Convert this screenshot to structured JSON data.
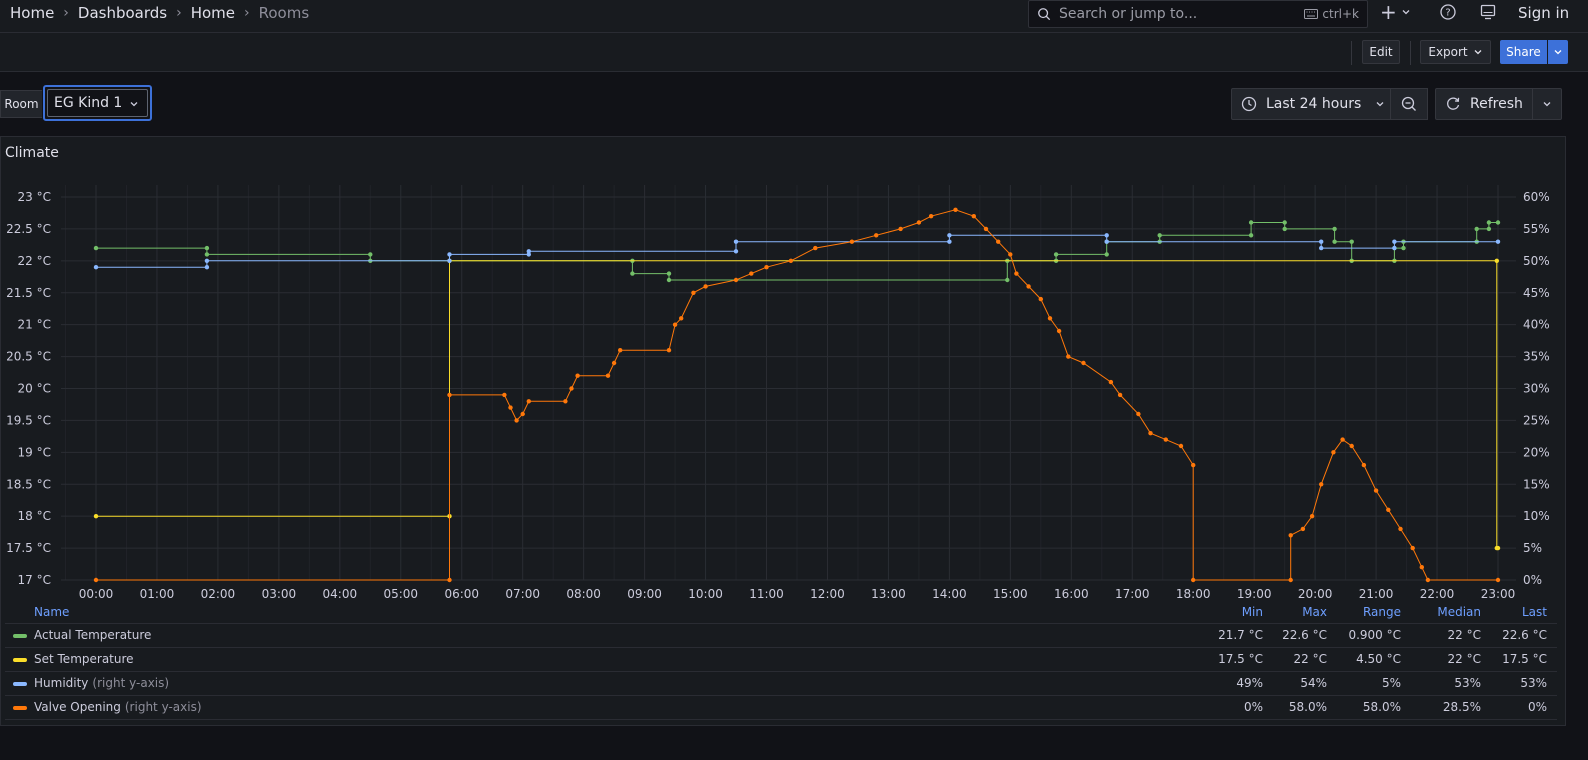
{
  "breadcrumbs": [
    "Home",
    "Dashboards",
    "Home",
    "Rooms"
  ],
  "search": {
    "placeholder": "Search or jump to...",
    "shortcut": "ctrl+k"
  },
  "top_right": {
    "signin": "Sign in"
  },
  "toolbar": {
    "edit": "Edit",
    "export": "Export",
    "share": "Share"
  },
  "variables": {
    "room_label": "Room",
    "room_value": "EG Kind 1"
  },
  "time_controls": {
    "range": "Last 24 hours",
    "refresh": "Refresh"
  },
  "panel": {
    "title": "Climate"
  },
  "colors": {
    "green": "#73bf69",
    "yellow": "#fade2a",
    "blue": "#8ab8ff",
    "orange": "#ff780a",
    "accent": "#3d71d9"
  },
  "legend": {
    "columns": [
      "Name",
      "Min",
      "Max",
      "Range",
      "Median",
      "Last"
    ],
    "rows": [
      {
        "name": "Actual Temperature",
        "axis": "",
        "color": "#73bf69",
        "min": "21.7 °C",
        "max": "22.6 °C",
        "range": "0.900 °C",
        "median": "22 °C",
        "last": "22.6 °C"
      },
      {
        "name": "Set Temperature",
        "axis": "",
        "color": "#fade2a",
        "min": "17.5 °C",
        "max": "22 °C",
        "range": "4.50 °C",
        "median": "22 °C",
        "last": "17.5 °C"
      },
      {
        "name": "Humidity",
        "axis": "(right y-axis)",
        "color": "#8ab8ff",
        "min": "49%",
        "max": "54%",
        "range": "5%",
        "median": "53%",
        "last": "53%"
      },
      {
        "name": "Valve Opening",
        "axis": "(right y-axis)",
        "color": "#ff780a",
        "min": "0%",
        "max": "58.0%",
        "range": "58.0%",
        "median": "28.5%",
        "last": "0%"
      }
    ]
  },
  "chart_data": {
    "type": "line",
    "title": "Climate",
    "x_ticks": [
      "00:00",
      "01:00",
      "02:00",
      "03:00",
      "04:00",
      "05:00",
      "06:00",
      "07:00",
      "08:00",
      "09:00",
      "10:00",
      "11:00",
      "12:00",
      "13:00",
      "14:00",
      "15:00",
      "16:00",
      "17:00",
      "18:00",
      "19:00",
      "20:00",
      "21:00",
      "22:00",
      "23:00"
    ],
    "x_unit": "hours",
    "x_range": [
      0,
      23
    ],
    "y_left": {
      "ticks": [
        "17 °C",
        "17.5 °C",
        "18 °C",
        "18.5 °C",
        "19 °C",
        "19.5 °C",
        "20 °C",
        "20.5 °C",
        "21 °C",
        "21.5 °C",
        "22 °C",
        "22.5 °C",
        "23 °C"
      ],
      "range": [
        17,
        23
      ]
    },
    "y_right": {
      "ticks": [
        "0%",
        "5%",
        "10%",
        "15%",
        "20%",
        "25%",
        "30%",
        "35%",
        "40%",
        "45%",
        "50%",
        "55%",
        "60%"
      ],
      "range": [
        0,
        60
      ]
    },
    "grid": true,
    "legend": "bottom-table",
    "series": [
      {
        "name": "Actual Temperature",
        "axis": "left",
        "color": "#73bf69",
        "points": [
          [
            0,
            22.2
          ],
          [
            1.82,
            22.2
          ],
          [
            1.82,
            22.1
          ],
          [
            4.5,
            22.1
          ],
          [
            4.5,
            22.0
          ],
          [
            8.8,
            22.0
          ],
          [
            8.8,
            21.8
          ],
          [
            9.4,
            21.8
          ],
          [
            9.4,
            21.7
          ],
          [
            14.95,
            21.7
          ],
          [
            14.95,
            22.0
          ],
          [
            15.75,
            22.0
          ],
          [
            15.75,
            22.1
          ],
          [
            16.58,
            22.1
          ],
          [
            16.58,
            22.3
          ],
          [
            17.45,
            22.3
          ],
          [
            17.45,
            22.4
          ],
          [
            18.95,
            22.4
          ],
          [
            18.95,
            22.6
          ],
          [
            19.5,
            22.6
          ],
          [
            19.5,
            22.5
          ],
          [
            20.32,
            22.5
          ],
          [
            20.32,
            22.3
          ],
          [
            20.6,
            22.3
          ],
          [
            20.6,
            22.0
          ],
          [
            21.3,
            22.0
          ],
          [
            21.3,
            22.2
          ],
          [
            21.45,
            22.2
          ],
          [
            21.45,
            22.3
          ],
          [
            22.65,
            22.3
          ],
          [
            22.65,
            22.5
          ],
          [
            22.85,
            22.5
          ],
          [
            22.85,
            22.6
          ],
          [
            23.0,
            22.6
          ]
        ]
      },
      {
        "name": "Set Temperature",
        "axis": "left",
        "color": "#fade2a",
        "points": [
          [
            0,
            18.0
          ],
          [
            5.8,
            18.0
          ],
          [
            5.8,
            22.0
          ],
          [
            22.98,
            22.0
          ],
          [
            22.98,
            17.5
          ],
          [
            23.0,
            17.5
          ]
        ]
      },
      {
        "name": "Humidity",
        "axis": "right",
        "color": "#8ab8ff",
        "points": [
          [
            0,
            49
          ],
          [
            1.82,
            49
          ],
          [
            1.82,
            50
          ],
          [
            5.8,
            50
          ],
          [
            5.8,
            51
          ],
          [
            7.1,
            51
          ],
          [
            7.1,
            51.5
          ],
          [
            10.5,
            51.5
          ],
          [
            10.5,
            53
          ],
          [
            14.0,
            53
          ],
          [
            14.0,
            54
          ],
          [
            16.58,
            54
          ],
          [
            16.58,
            53
          ],
          [
            20.1,
            53
          ],
          [
            20.1,
            52
          ],
          [
            21.3,
            52
          ],
          [
            21.3,
            53
          ],
          [
            23.0,
            53
          ]
        ]
      },
      {
        "name": "Valve Opening",
        "axis": "right",
        "color": "#ff780a",
        "points": [
          [
            0,
            0
          ],
          [
            5.8,
            0
          ],
          [
            5.8,
            29
          ],
          [
            6.7,
            29
          ],
          [
            6.8,
            27
          ],
          [
            6.9,
            25
          ],
          [
            7.0,
            26
          ],
          [
            7.1,
            28
          ],
          [
            7.7,
            28
          ],
          [
            7.8,
            30
          ],
          [
            7.9,
            32
          ],
          [
            8.4,
            32
          ],
          [
            8.5,
            34
          ],
          [
            8.6,
            36
          ],
          [
            9.4,
            36
          ],
          [
            9.5,
            40
          ],
          [
            9.6,
            41
          ],
          [
            9.8,
            45
          ],
          [
            10.0,
            46
          ],
          [
            10.5,
            47
          ],
          [
            10.75,
            48
          ],
          [
            11.0,
            49
          ],
          [
            11.4,
            50
          ],
          [
            11.8,
            52
          ],
          [
            12.4,
            53
          ],
          [
            12.8,
            54
          ],
          [
            13.2,
            55
          ],
          [
            13.5,
            56
          ],
          [
            13.7,
            57
          ],
          [
            14.1,
            58
          ],
          [
            14.4,
            57
          ],
          [
            14.6,
            55
          ],
          [
            14.8,
            53
          ],
          [
            15.0,
            51
          ],
          [
            15.1,
            48
          ],
          [
            15.3,
            46
          ],
          [
            15.5,
            44
          ],
          [
            15.65,
            41
          ],
          [
            15.8,
            39
          ],
          [
            15.95,
            35
          ],
          [
            16.2,
            34
          ],
          [
            16.65,
            31
          ],
          [
            16.8,
            29
          ],
          [
            17.1,
            26
          ],
          [
            17.3,
            23
          ],
          [
            17.55,
            22
          ],
          [
            17.8,
            21
          ],
          [
            18.0,
            18
          ],
          [
            18.0,
            0
          ],
          [
            19.6,
            0
          ],
          [
            19.6,
            7
          ],
          [
            19.8,
            8
          ],
          [
            19.95,
            10
          ],
          [
            20.1,
            15
          ],
          [
            20.3,
            20
          ],
          [
            20.45,
            22
          ],
          [
            20.6,
            21
          ],
          [
            20.8,
            18
          ],
          [
            21.0,
            14
          ],
          [
            21.2,
            11
          ],
          [
            21.4,
            8
          ],
          [
            21.6,
            5
          ],
          [
            21.75,
            2
          ],
          [
            21.85,
            0
          ],
          [
            23.0,
            0
          ]
        ]
      }
    ]
  }
}
